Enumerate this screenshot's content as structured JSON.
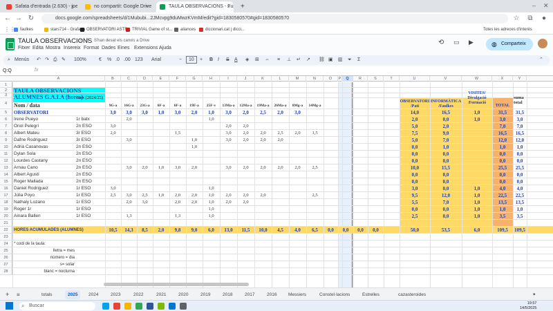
{
  "browser": {
    "tabs": [
      {
        "label": "Safata d'entrada (2.630) - jperu",
        "fav_color": "#ea4335",
        "active": false
      },
      {
        "label": "no compartit: Google Drive",
        "fav_color": "#fbbc04",
        "active": false
      },
      {
        "label": "TAULA OBSERVACIONS - Fulls",
        "fav_color": "#0f9d58",
        "active": true
      }
    ],
    "url": "docs.google.com/spreadsheets/d/1Mububi...2JMcvpg9duMwzKVmM/edit?gid=1830580570#gid=1830580570",
    "bookmarks": [
      {
        "label": "faulkes",
        "color": "#4285f4"
      },
      {
        "label": "stars714 - Grafana",
        "color": "#f4b400"
      },
      {
        "label": "OBSERVATORI ASTR...",
        "color": "#202124"
      },
      {
        "label": "TRIVIAL Game of st...",
        "color": "#c5221f"
      },
      {
        "label": "aliances",
        "color": "#5f6368"
      },
      {
        "label": "diccionari.cat | dicci...",
        "color": "#d93025"
      }
    ],
    "all_bookmarks": "Totes les adreces d'interès"
  },
  "doc": {
    "title": "TAULA OBSERVACIONS",
    "saved_status": "S'han desat els canvis a Drive",
    "menu": [
      "Fitxer",
      "Edita",
      "Mostra",
      "Insereix",
      "Format",
      "Dades",
      "Eines",
      "Extensions",
      "Ajuda"
    ],
    "share_label": "Comparteix"
  },
  "toolbar": {
    "menus": "Menús",
    "zoom": "100%",
    "euro": "€",
    "percent": "%",
    "dec1": ".0",
    "dec2": ".00",
    "numfmt": "123",
    "font": "Arial",
    "font_size": "10"
  },
  "formula_bar": {
    "name_box": "Q:Q",
    "fx": "fx"
  },
  "sheet": {
    "col_headers": [
      "A",
      "B",
      "C",
      "D",
      "E",
      "F",
      "G",
      "H",
      "I",
      "J",
      "K",
      "L",
      "M",
      "N",
      "O",
      "P",
      "Q",
      "R",
      "S",
      "T",
      "U",
      "V",
      "W",
      "X",
      "Y"
    ],
    "row_numbers": [
      "1",
      "2",
      "3",
      "4",
      "5",
      "6",
      "7",
      "8",
      "9",
      "10",
      "11",
      "12",
      "13",
      "14",
      "15",
      "16",
      "17",
      "18",
      "19",
      "20",
      "21",
      "22",
      "23",
      "24",
      "25",
      "26",
      "27",
      "28"
    ],
    "title_line1": "TAULA OBSERVACIONS",
    "title_line2": "ALUMNES G.A.I.A (hores)",
    "hdr_name": "Nom / data",
    "hdr_course": "curs (2024/25)",
    "dates": [
      "9G-a",
      "16G-a",
      "23G-a",
      "6F-a",
      "6F-a",
      "19F-a",
      "25F-v",
      "13Ma-a",
      "12Ma-a",
      "19Ma-a",
      "26Ma-a",
      "8Mg-a",
      "14Mg-a"
    ],
    "hdr_obs": "OBSERVATORI /Pati",
    "hdr_inf": "INFORMÀTICA /Faulkes",
    "hdr_vis": "VISITES/ Divulgació /Formació",
    "hdr_total": "TOTAL",
    "hdr_suma": "suma total",
    "obs_row": {
      "label": "OBSERVATORI",
      "vals": [
        "3,0",
        "3,0",
        "3,0",
        "1,0",
        "3,0",
        "2,0",
        "1,0",
        "3,0",
        "2,0",
        "2,5",
        "2,0",
        "3,0"
      ],
      "u": "14,0",
      "v": "16,5",
      "w": "1,0",
      "x": "31,5",
      "y": "31,5"
    },
    "students": [
      {
        "name": "Irene Pueyo",
        "course": "1r batx",
        "u": "2,0",
        "v": "0,0",
        "w": "1,0",
        "x": "3,0",
        "y": "3,0"
      },
      {
        "name": "Oriol Pelegrí",
        "course": "2n ESO",
        "u": "5,0",
        "v": "2,0",
        "w": "",
        "x": "7,0",
        "y": "7,0"
      },
      {
        "name": "Albert Mateu",
        "course": "3r ESO",
        "u": "7,5",
        "v": "9,0",
        "w": "",
        "x": "16,5",
        "y": "16,5"
      },
      {
        "name": "Dafne Rodriguez",
        "course": "3r ESO",
        "u": "5,0",
        "v": "7,0",
        "w": "",
        "x": "12,0",
        "y": "12,0"
      },
      {
        "name": "Adrià Casanovas",
        "course": "2n ESO",
        "u": "0,0",
        "v": "1,0",
        "w": "",
        "x": "1,0",
        "y": "1,0"
      },
      {
        "name": "Dylan Sola",
        "course": "2n ESO",
        "u": "0,0",
        "v": "0,0",
        "w": "",
        "x": "0,0",
        "y": "0,0"
      },
      {
        "name": "Lourdes Castany",
        "course": "2n ESO",
        "u": "0,0",
        "v": "0,0",
        "w": "",
        "x": "0,0",
        "y": "0,0"
      },
      {
        "name": "Arnau Cano",
        "course": "2n ESO",
        "u": "10,0",
        "v": "15,5",
        "w": "",
        "x": "25,5",
        "y": "25,5"
      },
      {
        "name": "Albert Agustí",
        "course": "2n ESO",
        "u": "0,0",
        "v": "0,0",
        "w": "",
        "x": "0,0",
        "y": "0,0"
      },
      {
        "name": "Roger Mallada",
        "course": "2n ESO",
        "u": "0,0",
        "v": "0,0",
        "w": "",
        "x": "0,0",
        "y": "0,0"
      },
      {
        "name": "Daniel Rodriguez",
        "course": "1r ESO",
        "u": "3,0",
        "v": "0,0",
        "w": "1,0",
        "x": "4,0",
        "y": "4,0"
      },
      {
        "name": "Júlia Poyo",
        "course": "1r ESO",
        "u": "9,5",
        "v": "12,0",
        "w": "1,0",
        "x": "22,5",
        "y": "22,5"
      },
      {
        "name": "Nathaly Lozano",
        "course": "1r ESO",
        "u": "5,5",
        "v": "7,0",
        "w": "1,0",
        "x": "13,5",
        "y": "13,5"
      },
      {
        "name": "Roger 1r",
        "course": "1r ESO",
        "u": "0,0",
        "v": "0,0",
        "w": "1,0",
        "x": "1,0",
        "y": "1,0"
      },
      {
        "name": "Ainara Ballen",
        "course": "1r ESO",
        "u": "2,5",
        "v": "0,0",
        "w": "1,0",
        "x": "3,5",
        "y": "3,5"
      }
    ],
    "grid_vals": [
      [
        "",
        "2,0",
        "",
        "",
        "",
        "",
        "1,0",
        "",
        "",
        "",
        "",
        "",
        ""
      ],
      [
        "3,0",
        "",
        "",
        "",
        "",
        "",
        "",
        "2,0",
        "2,0",
        "",
        "",
        "",
        ""
      ],
      [
        "2,0",
        "",
        "",
        "",
        "1,5",
        "",
        "",
        "3,0",
        "2,0",
        "2,0",
        "2,5",
        "2,0",
        "1,5"
      ],
      [
        "",
        "3,0",
        "",
        "",
        "",
        "1,0",
        "",
        "3,0",
        "2,0",
        "2,0",
        "2,0",
        "",
        ""
      ],
      [
        "",
        "",
        "",
        "",
        "",
        "1,0",
        "",
        "",
        "",
        "",
        "",
        "",
        ""
      ],
      [
        "",
        "",
        "",
        "",
        "",
        "",
        "",
        "",
        "",
        "",
        "",
        "",
        ""
      ],
      [
        "",
        "",
        "",
        "",
        "",
        "",
        "",
        "",
        "",
        "",
        "",
        "",
        ""
      ],
      [
        "",
        "3,0",
        "2,0",
        "1,0",
        "3,0",
        "2,0",
        "",
        "3,0",
        "2,0",
        "2,0",
        "2,0",
        "2,0",
        "2,5"
      ],
      [
        "",
        "",
        "",
        "",
        "",
        "",
        "",
        "",
        "",
        "",
        "",
        "",
        ""
      ],
      [
        "",
        "",
        "",
        "",
        "",
        "",
        "",
        "",
        "",
        "",
        "",
        "",
        ""
      ],
      [
        "3,0",
        "",
        "",
        "",
        "",
        "",
        "1,0",
        "",
        "",
        "",
        "",
        "",
        ""
      ],
      [
        "2,5",
        "3,0",
        "2,5",
        "1,0",
        "2,0",
        "2,0",
        "1,0",
        "2,0",
        "2,0",
        "2,0",
        "",
        "",
        "2,5"
      ],
      [
        "",
        "2,0",
        "3,0",
        "",
        "2,0",
        "2,0",
        "1,0",
        "2,0",
        "2,0",
        "",
        "",
        "",
        ""
      ],
      [
        "",
        "",
        "",
        "",
        "",
        "",
        "1,0",
        "",
        "",
        "",
        "",
        "",
        ""
      ],
      [
        "",
        "1,3",
        "",
        "",
        "1,3",
        "",
        "1,0",
        "",
        "",
        "",
        "",
        "",
        ""
      ]
    ],
    "totals": {
      "label": "HORES ACUMULADES (ALUMNES)",
      "vals": [
        "10,5",
        "14,3",
        "8,5",
        "2,0",
        "9,8",
        "9,0",
        "6,0",
        "13,0",
        "11,5",
        "10,0",
        "4,5",
        "4,0",
        "6,5",
        "0,0",
        "0,0",
        "0,0",
        "0,0"
      ],
      "u": "50,0",
      "v": "53,5",
      "w": "6,0",
      "x": "109,5",
      "y": "109,5"
    },
    "legend": [
      "* codi de la taula:",
      "lletra = mes",
      "número = dia",
      "s= solar",
      "blanc = nocturna"
    ]
  },
  "sheet_tabs": {
    "items": [
      "totals",
      "2025",
      "2024",
      "2023",
      "2022",
      "2021",
      "2020",
      "2019",
      "2018",
      "2017",
      "2016",
      "Messiers",
      "Constel·lacions",
      "Estrelles",
      "cazasteroides"
    ],
    "active": "2025"
  },
  "taskbar": {
    "search": "Buscar",
    "time": "19:57",
    "date": "14/5/2025"
  },
  "colors": {
    "cyan": "#00ffff",
    "yellow": "#ffd966",
    "orange": "#f6b26b",
    "blue_text": "#1f3ea8"
  }
}
